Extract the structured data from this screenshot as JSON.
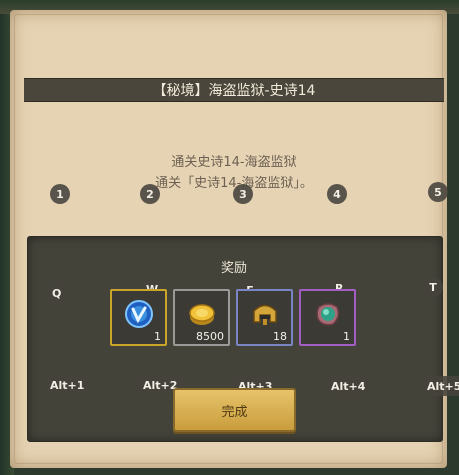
{
  "title": "【秘境】海盗监狱-史诗14",
  "description": {
    "line1": "通关史诗14-海盗监狱",
    "line2": "通关「史诗14-海盗监狱」。"
  },
  "hotkeys_number": [
    "1",
    "2",
    "3",
    "4",
    "5"
  ],
  "hotkeys_letter": [
    "Q",
    "W",
    "E",
    "R",
    "T"
  ],
  "hotkeys_alt": [
    "Alt+1",
    "Alt+2",
    "Alt+3",
    "Alt+4",
    "Alt+5"
  ],
  "rewards": {
    "title": "奖励",
    "items": [
      {
        "icon": "blue-crystal-icon",
        "quantity": "1",
        "frame": "gold"
      },
      {
        "icon": "gold-coin-icon",
        "quantity": "8500",
        "frame": "gray"
      },
      {
        "icon": "helmet-icon",
        "quantity": "18",
        "frame": "blue"
      },
      {
        "icon": "green-orb-icon",
        "quantity": "1",
        "frame": "purple"
      }
    ]
  },
  "complete_button": "完成",
  "colors": {
    "parchment": "#e6d3b3",
    "title_bar": "#4a463c",
    "panel": "#44433a",
    "button": "#d9b257"
  }
}
